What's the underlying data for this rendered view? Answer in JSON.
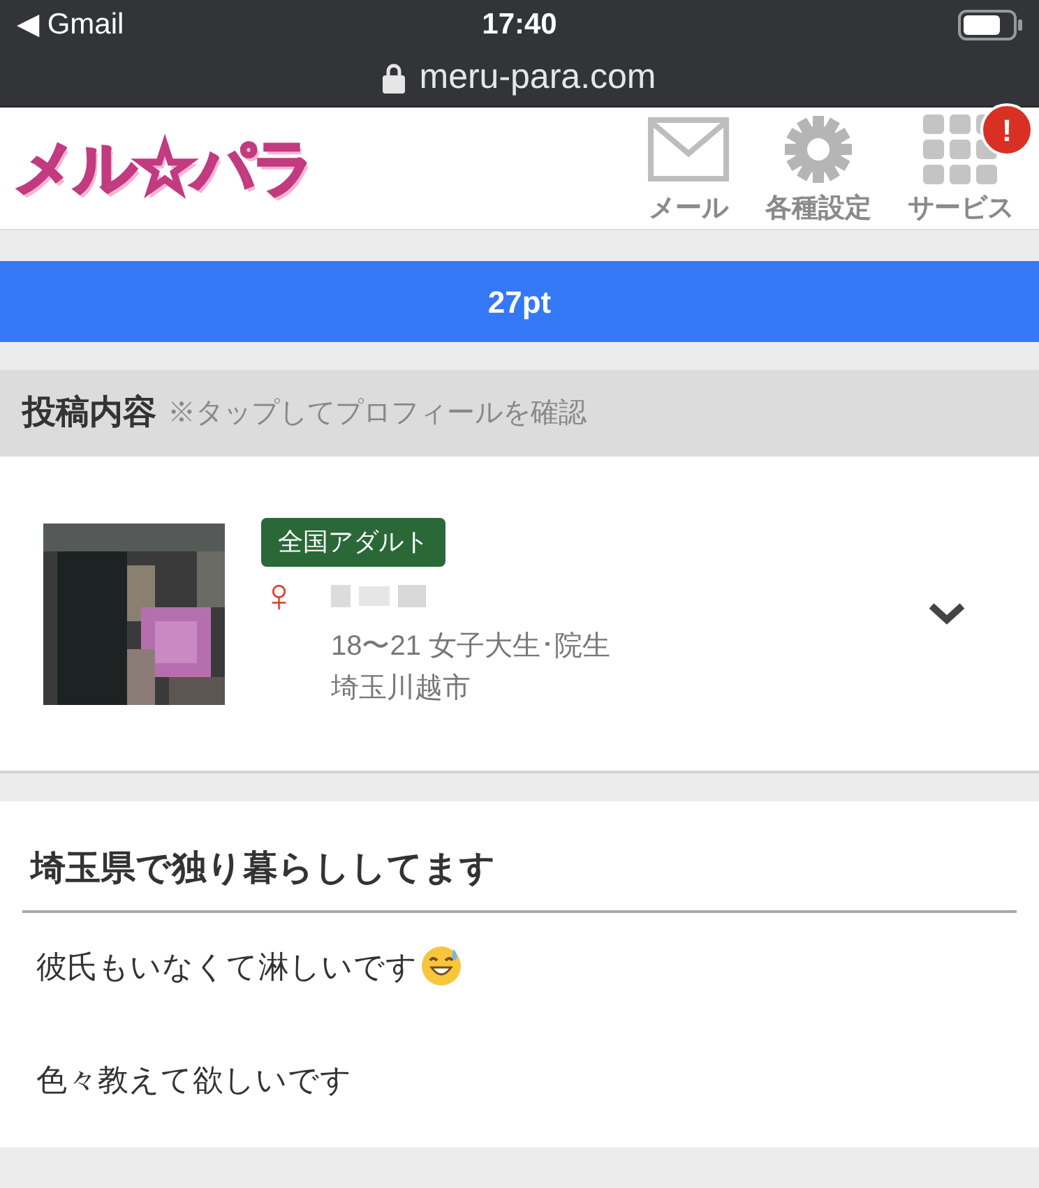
{
  "status_bar": {
    "back_app": "◀ Gmail",
    "time": "17:40"
  },
  "address_bar": {
    "url": "meru-para.com"
  },
  "header": {
    "logo": "メル☆パラ",
    "nav": [
      {
        "kind": "mail",
        "label": "メール",
        "alert": false
      },
      {
        "kind": "settings",
        "label": "各種設定",
        "alert": false
      },
      {
        "kind": "services",
        "label": "サービス",
        "alert": true,
        "badge": "!"
      }
    ]
  },
  "points": "27pt",
  "section": {
    "title": "投稿内容",
    "note": "※タップしてプロフィールを確認"
  },
  "profile": {
    "tag": "全国アダルト",
    "gender": "♀",
    "age_job": "18〜21 女子大生･院生",
    "location": "埼玉川越市",
    "expanded": false
  },
  "post": {
    "title": "埼玉県で独り暮らししてます",
    "lines": [
      "彼氏もいなくて淋しいです",
      "色々教えて欲しいです"
    ]
  }
}
